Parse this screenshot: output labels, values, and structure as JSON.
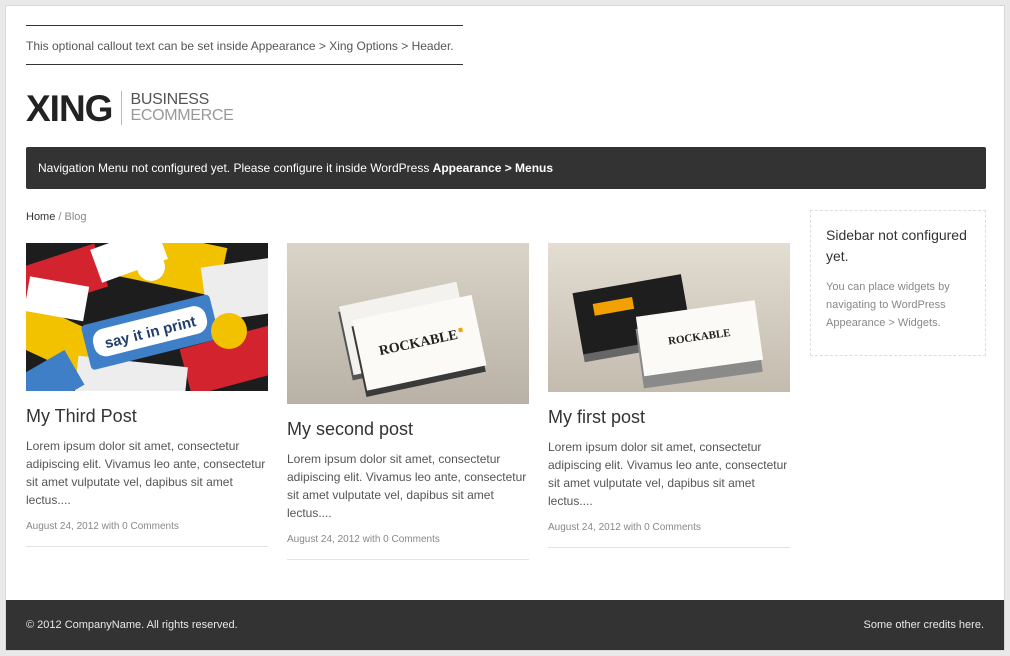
{
  "header": {
    "callout": "This optional callout text can be set inside Appearance > Xing Options > Header.",
    "logo_main": "XING",
    "logo_sub_1": "BUSINESS",
    "logo_sub_2": "ECOMMERCE"
  },
  "nav": {
    "message": "Navigation Menu not configured yet. Please configure it inside WordPress ",
    "message_strong": "Appearance > Menus"
  },
  "breadcrumb": {
    "home": "Home",
    "separator": " / ",
    "current": "Blog"
  },
  "posts": [
    {
      "title": "My Third Post",
      "excerpt": "Lorem ipsum dolor sit amet, consectetur adipiscing elit. Vivamus leo ante, consectetur sit amet vulputate vel, dapibus sit amet lectus....",
      "meta": "August 24, 2012 with 0 Comments",
      "image_text": "say it in print"
    },
    {
      "title": "My second post",
      "excerpt": "Lorem ipsum dolor sit amet, consectetur adipiscing elit. Vivamus leo ante, consectetur sit amet vulputate vel, dapibus sit amet lectus....",
      "meta": "August 24, 2012 with 0 Comments",
      "image_text": "ROCKABLE"
    },
    {
      "title": "My first post",
      "excerpt": "Lorem ipsum dolor sit amet, consectetur adipiscing elit. Vivamus leo ante, consectetur sit amet vulputate vel, dapibus sit amet lectus....",
      "meta": "August 24, 2012 with 0 Comments",
      "image_text": "ROCKABLE"
    }
  ],
  "sidebar": {
    "title": "Sidebar not configured yet.",
    "text": "You can place widgets by navigating to WordPress Appearance > Widgets."
  },
  "footer": {
    "copyright": "© 2012 CompanyName. All rights reserved.",
    "credits": "Some other credits here."
  },
  "colors": {
    "dark_bar": "#333333",
    "accent_yellow": "#f2c200",
    "accent_red": "#d3232f",
    "accent_blue": "#3f7fc7"
  }
}
